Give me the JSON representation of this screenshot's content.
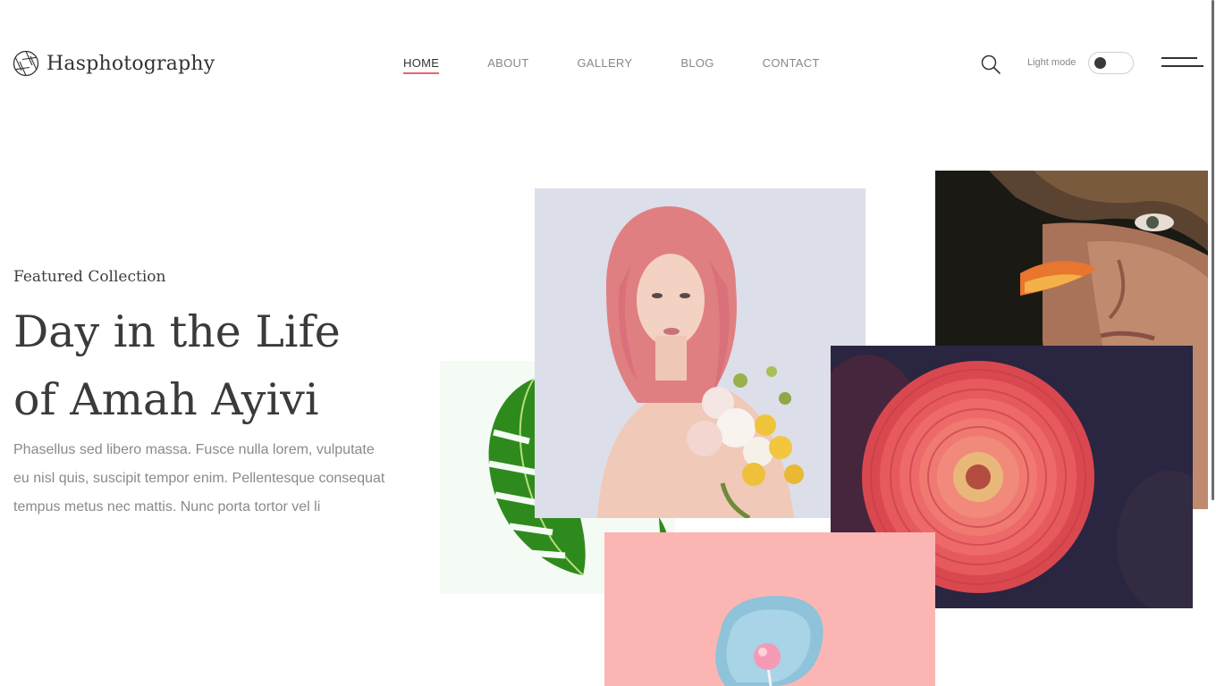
{
  "brand": {
    "name": "Hasphotography",
    "logo_icon": "aperture-icon"
  },
  "nav": {
    "items": [
      {
        "label": "HOME",
        "active": true
      },
      {
        "label": "ABOUT",
        "active": false
      },
      {
        "label": "GALLERY",
        "active": false
      },
      {
        "label": "BLOG",
        "active": false
      },
      {
        "label": "CONTACT",
        "active": false
      }
    ],
    "accent_color": "#e8666d"
  },
  "header_controls": {
    "search_icon": "search-icon",
    "light_mode_label": "Light mode",
    "menu_icon": "hamburger-menu-icon"
  },
  "hero": {
    "subtitle": "Featured Collection",
    "title_line1": "Day in the Life",
    "title_line2": "of Amah Ayivi",
    "body": "Phasellus sed libero massa. Fusce nulla lorem, vulputate eu nisl quis, suscipit tempor enim. Pellentesque consequat tempus metus nec mattis. Nunc porta tortor vel li"
  },
  "gallery": {
    "photos": [
      {
        "name": "monstera-leaf-photo"
      },
      {
        "name": "pink-hair-woman-with-flowers-photo"
      },
      {
        "name": "man-face-closeup-photo"
      },
      {
        "name": "red-dahlia-flower-photo"
      },
      {
        "name": "lollipop-on-blue-dish-photo"
      }
    ]
  }
}
